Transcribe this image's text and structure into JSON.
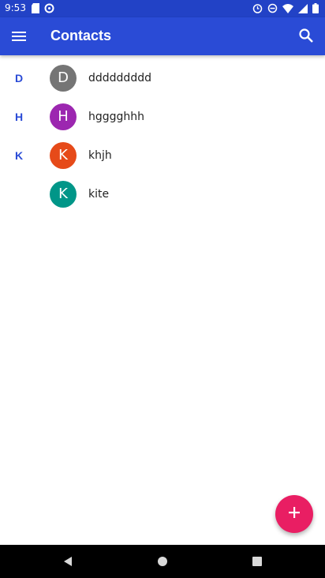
{
  "status_bar": {
    "time": "9:53",
    "left_icons": [
      "sd-card-icon",
      "sync-icon"
    ],
    "right_icons": [
      "alarm-icon",
      "do-not-disturb-icon",
      "wifi-icon",
      "signal-icon",
      "battery-icon"
    ]
  },
  "app_bar": {
    "title": "Contacts",
    "menu_icon": "menu-icon",
    "search_icon": "search-icon"
  },
  "contacts": [
    {
      "section": "D",
      "initial": "D",
      "name": "ddddddddd",
      "color": "#757575"
    },
    {
      "section": "H",
      "initial": "H",
      "name": "hgggghhh",
      "color": "#9c27b0"
    },
    {
      "section": "K",
      "initial": "K",
      "name": "khjh",
      "color": "#e64a19"
    },
    {
      "section": "",
      "initial": "K",
      "name": "kite",
      "color": "#009688"
    }
  ],
  "fab": {
    "icon": "add-icon",
    "color": "#e91e63"
  },
  "nav_bar": {
    "buttons": [
      "back-icon",
      "home-icon",
      "recents-icon"
    ]
  },
  "colors": {
    "primary": "#2a4bd6",
    "status": "#2242c6",
    "accent": "#e91e63"
  }
}
